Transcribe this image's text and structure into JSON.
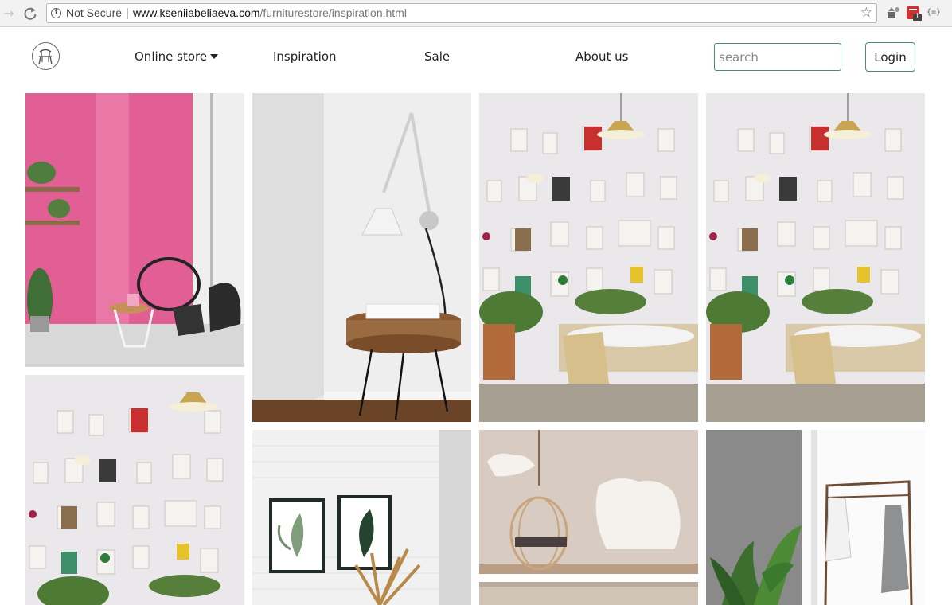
{
  "browser": {
    "security_label": "Not Secure",
    "url_host": "www.kseniiabeliaeva.com",
    "url_path": "/furniturestore/inspiration.html",
    "extension_badge": "1",
    "extension_label": "{=}"
  },
  "header": {
    "logo_icon": "chair-logo-icon",
    "menu": {
      "online_store": "Online store",
      "inspiration": "Inspiration",
      "sale": "Sale",
      "about": "About us"
    },
    "search_placeholder": "search",
    "login_label": "Login"
  },
  "gallery": {
    "images": [
      "pink-wall-room-image",
      "wall-lamp-stool-image",
      "magazine-wall-cafe-image",
      "magazine-wall-cafe-image",
      "magazine-wall-cafe-image",
      "framed-leaf-prints-image",
      "hanging-chair-image",
      "clothes-rack-plant-image",
      "interior-image"
    ]
  },
  "colors": {
    "accent": "#4a8a85",
    "pink": "#e05f95"
  }
}
